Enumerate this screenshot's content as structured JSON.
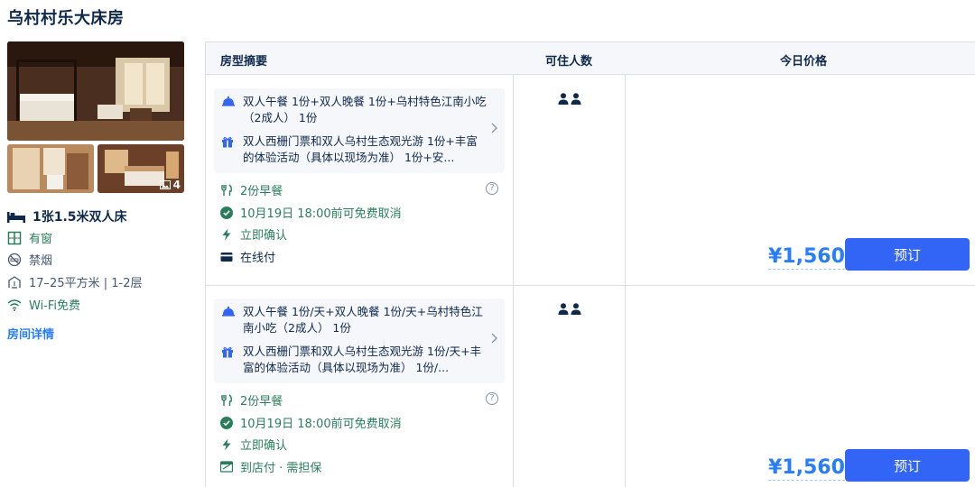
{
  "room": {
    "title": "乌村村乐大床房",
    "photo_count": "4",
    "bed": "1张1.5米双人床",
    "facilities": [
      {
        "icon": "window-icon",
        "label": "有窗"
      },
      {
        "icon": "no-smoking-icon",
        "label": "禁烟"
      },
      {
        "icon": "area-icon",
        "label": "17–25平方米 | 1-2层"
      },
      {
        "icon": "wifi-icon",
        "label": "Wi-Fi免费"
      }
    ],
    "details_link": "房间详情"
  },
  "table": {
    "headers": [
      "房型摘要",
      "可住人数",
      "今日价格"
    ],
    "rows": [
      {
        "package": [
          {
            "icon": "dining-icon",
            "text": "双人午餐 1份+双人晚餐 1份+乌村特色江南小吃（2成人） 1份"
          },
          {
            "icon": "gift-icon",
            "text": "双人西栅门票和双人乌村生态观光游 1份+丰富的体验活动（具体以现场为准） 1份+安..."
          }
        ],
        "breakfast": "2份早餐",
        "cancel": "10月19日 18:00前可免费取消",
        "confirm": "立即确认",
        "payment": "在线付",
        "payment_icon": "card-icon",
        "price": "¥1,560",
        "book": "预订"
      },
      {
        "package": [
          {
            "icon": "dining-icon",
            "text": "双人午餐 1份/天+双人晚餐 1份/天+乌村特色江南小吃（2成人） 1份"
          },
          {
            "icon": "gift-icon",
            "text": "双人西栅门票和双人乌村生态观光游 1份/天+丰富的体验活动（具体以现场为准） 1份/..."
          }
        ],
        "breakfast": "2份早餐",
        "cancel": "10月19日 18:00前可免费取消",
        "confirm": "立即确认",
        "payment": "到店付 · 需担保",
        "payment_icon": "pay-at-hotel-icon",
        "price": "¥1,560",
        "book": "预订"
      }
    ]
  },
  "colors": {
    "accent_blue": "#287dfa",
    "button_blue": "#3264f5",
    "green": "#287e5a",
    "text_dark": "#0f294d"
  }
}
